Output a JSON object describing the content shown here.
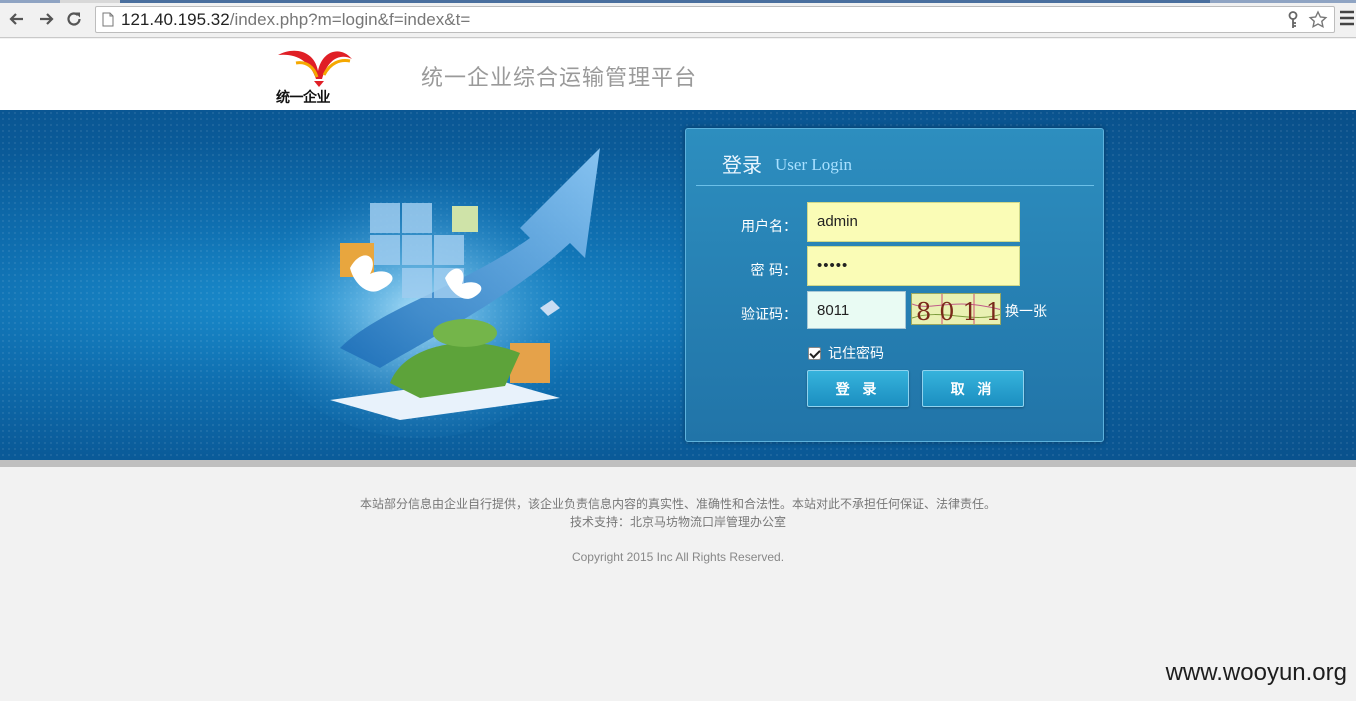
{
  "browser": {
    "url_host": "121.40.195.32",
    "url_path": "/index.php?m=login&f=index&t="
  },
  "header": {
    "logo_text": "统一企业",
    "site_title": "统一企业综合运输管理平台"
  },
  "login": {
    "title": "登录",
    "subtitle": "User Login",
    "username_label": "用户名：",
    "username_value": "admin",
    "password_label": "密 码：",
    "password_masked": "•••••",
    "captcha_label": "验证码：",
    "captcha_value": "8011",
    "captcha_image_text": "8011",
    "refresh_label": "换一张",
    "remember_label": "记住密码",
    "remember_checked": true,
    "submit_label": "登 录",
    "cancel_label": "取 消"
  },
  "footer": {
    "disclaimer": "本站部分信息由企业自行提供，该企业负责信息内容的真实性、准确性和合法性。本站对此不承担任何保证、法律责任。",
    "support": "技术支持：北京马坊物流口岸管理办公室",
    "copyright": "Copyright 2015 Inc All Rights Reserved."
  },
  "watermark": "www.wooyun.org",
  "colors": {
    "banner": "#0a5a98",
    "login_box": "#2a86b8",
    "input_fill": "#fafcb6",
    "button": "#27a2d0"
  }
}
